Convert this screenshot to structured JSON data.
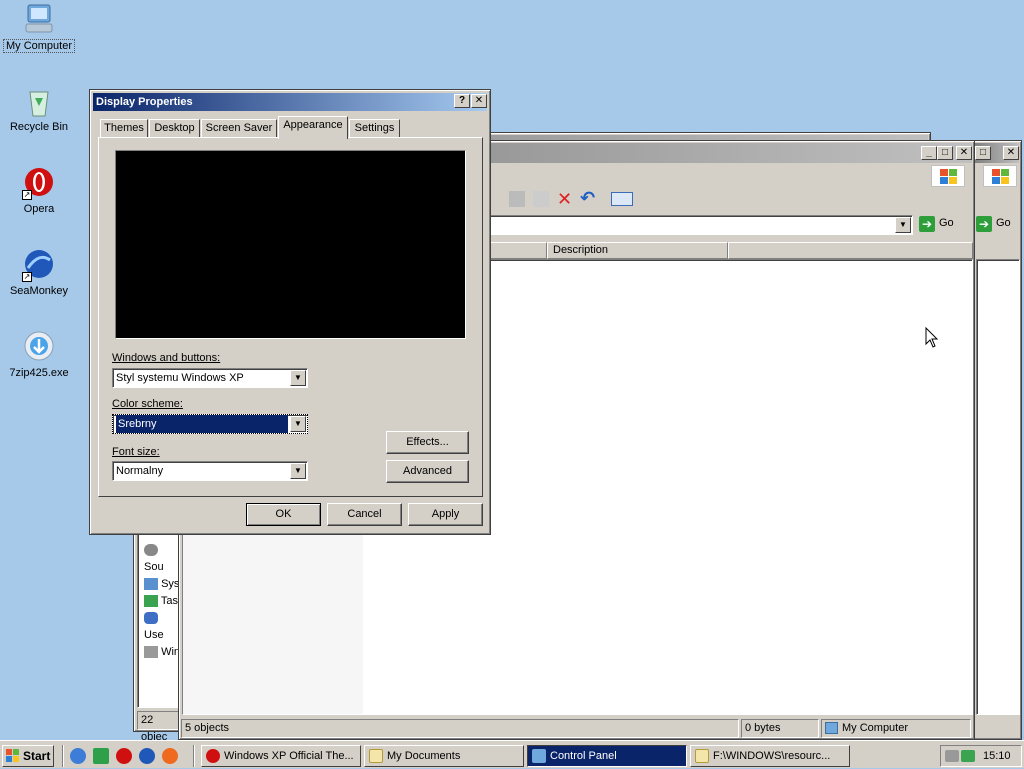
{
  "desktop": {
    "icons": [
      {
        "label": "My Computer"
      },
      {
        "label": "Recycle Bin"
      },
      {
        "label": "Opera"
      },
      {
        "label": "SeaMonkey"
      },
      {
        "label": "7zip425.exe"
      }
    ]
  },
  "explorer": {
    "go_label": "Go",
    "go_label_2": "Go",
    "column_description": "Description",
    "status_objects": "5 objects",
    "status_size": "0 bytes",
    "status_location": "My Computer",
    "back_status": "22 objec",
    "side_items": [
      "Sou",
      "Sys",
      "Tas",
      "Use",
      "Win"
    ]
  },
  "dialog": {
    "title": "Display Properties",
    "tabs": [
      "Themes",
      "Desktop",
      "Screen Saver",
      "Appearance",
      "Settings"
    ],
    "windows_buttons_label": "Windows and buttons:",
    "windows_buttons_value": "Styl systemu Windows XP",
    "color_scheme_label": "Color scheme:",
    "color_scheme_value": "Srebrny",
    "font_size_label": "Font size:",
    "font_size_value": "Normalny",
    "effects_label": "Effects...",
    "advanced_label": "Advanced",
    "ok_label": "OK",
    "cancel_label": "Cancel",
    "apply_label": "Apply"
  },
  "taskbar": {
    "start_label": "Start",
    "tasks": [
      {
        "label": "Windows XP Official The..."
      },
      {
        "label": "My Documents"
      },
      {
        "label": "Control Panel"
      },
      {
        "label": "F:\\WINDOWS\\resourc..."
      }
    ],
    "clock": "15:10"
  },
  "colors": {
    "desktop": "#a6c9ea",
    "active_title": "#0a246a",
    "face": "#d4d0c8"
  }
}
